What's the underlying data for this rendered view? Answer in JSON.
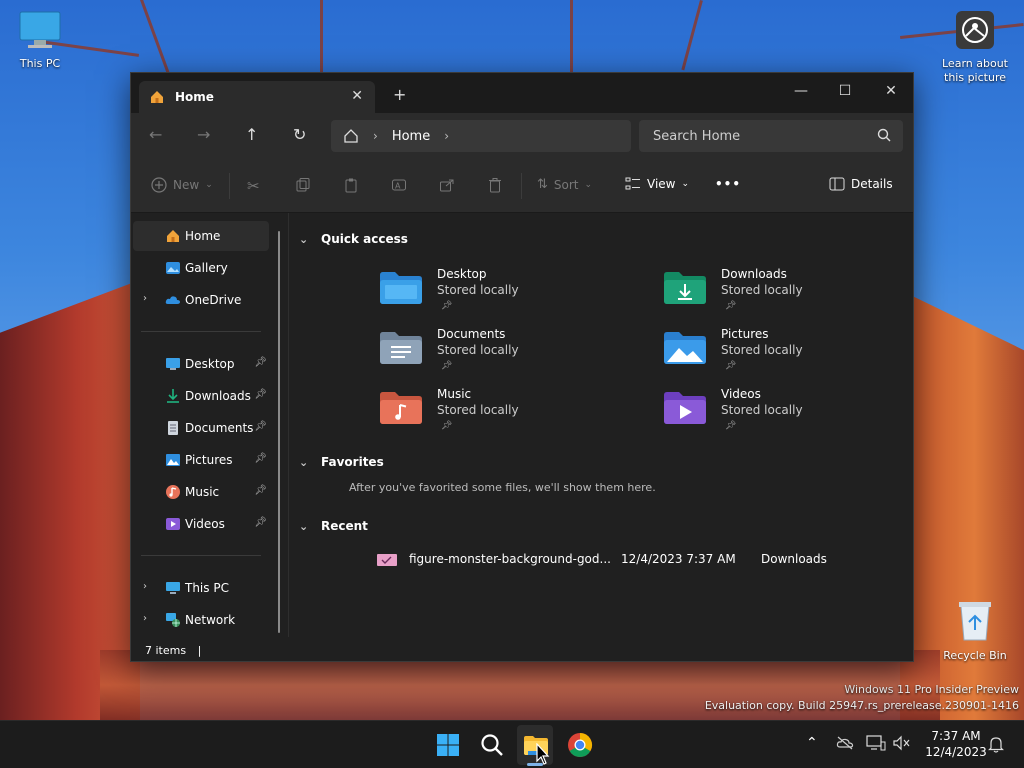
{
  "desktop": {
    "this_pc_label": "This PC",
    "learn_label": "Learn about this picture",
    "recycle_label": "Recycle Bin",
    "watermark_line1": "Windows 11 Pro Insider Preview",
    "watermark_line2": "Evaluation copy. Build 25947.rs_prerelease.230901-1416"
  },
  "window": {
    "tab_title": "Home",
    "close_tab": "✕",
    "new_tab": "+",
    "minimize": "—",
    "maximize": "☐",
    "close": "✕"
  },
  "address": {
    "crumb": "Home",
    "search_placeholder": "Search Home"
  },
  "commands": {
    "new_label": "New",
    "sort_label": "Sort",
    "view_label": "View",
    "more_label": "•••",
    "details_label": "Details"
  },
  "sidebar": {
    "home": "Home",
    "gallery": "Gallery",
    "onedrive": "OneDrive",
    "desktop": "Desktop",
    "downloads": "Downloads",
    "documents": "Documents",
    "pictures": "Pictures",
    "music": "Music",
    "videos": "Videos",
    "this_pc": "This PC",
    "network": "Network"
  },
  "main": {
    "quick_access": "Quick access",
    "favorites": "Favorites",
    "favorites_empty": "After you've favorited some files, we'll show them here.",
    "recent": "Recent",
    "folders": [
      {
        "name": "Desktop",
        "sub": "Stored locally",
        "color": "#3aa0e8"
      },
      {
        "name": "Downloads",
        "sub": "Stored locally",
        "color": "#1fa37a"
      },
      {
        "name": "Documents",
        "sub": "Stored locally",
        "color": "#8fa3b8"
      },
      {
        "name": "Pictures",
        "sub": "Stored locally",
        "color": "#3b9bea"
      },
      {
        "name": "Music",
        "sub": "Stored locally",
        "color": "#e8735a"
      },
      {
        "name": "Videos",
        "sub": "Stored locally",
        "color": "#8a5ad8"
      }
    ],
    "recent_file": {
      "name": "figure-monster-background-god...",
      "date": "12/4/2023 7:37 AM",
      "location": "Downloads"
    }
  },
  "status": {
    "items": "7 items",
    "cursor": "|"
  },
  "taskbar": {
    "time": "7:37 AM",
    "date": "12/4/2023"
  }
}
